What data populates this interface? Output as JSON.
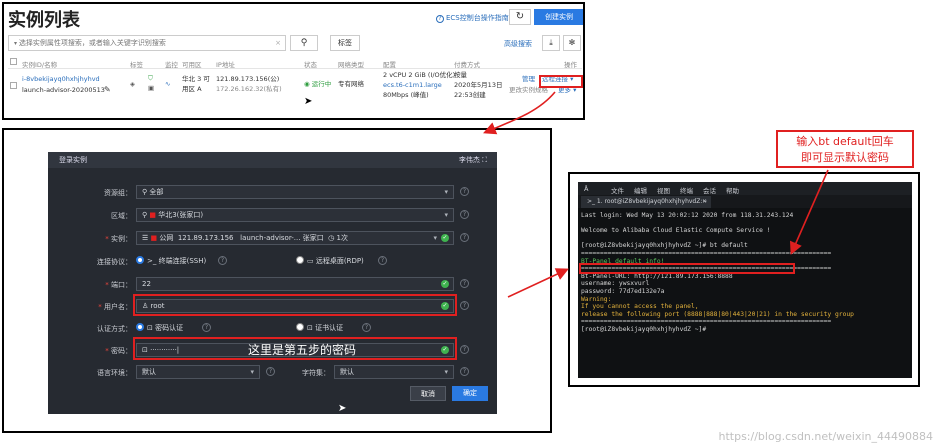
{
  "instance_list": {
    "title": "实例列表",
    "ecs_link": "ECS控制台操作指南",
    "create_button": "创建实例",
    "search_placeholder": "选择实例属性项搜索，或者输入关键字识别搜索",
    "tag_button": "标签",
    "advanced_search": "高级搜索",
    "columns": [
      "实例ID/名称",
      "标签",
      "监控",
      "可用区",
      "IP地址",
      "状态",
      "网络类型",
      "配置",
      "付费方式",
      "操作"
    ],
    "row": {
      "instance_id": "i-8vbekijayq0hxhjhyhvd",
      "instance_name": "launch-advisor-20200513",
      "zone_1": "华北 3 可",
      "zone_2": "用区 A",
      "ip_public": "121.89.173.156(公)",
      "ip_private": "172.26.162.32(私有)",
      "status": "运行中",
      "network_type": "专有网络",
      "config_1": "2 vCPU 2 GiB (I/O优化)",
      "config_2": "ecs.t6-c1m1.large",
      "config_3": "80Mbps (峰值)",
      "pay_1": "按量",
      "pay_2": "2020年5月13日",
      "pay_3": "22:53创建",
      "manage_link": "管理",
      "remote_link": "远程连接",
      "more_link": "更改实例规格",
      "more_2": "更多"
    }
  },
  "login_dialog": {
    "title": "登录实例",
    "header_right": "李伟杰",
    "fields": {
      "resource_group_label": "资源组：",
      "resource_group_value": "全部",
      "region_label": "区域：",
      "region_value": "华北3(张家口)",
      "instance_label": "实例：",
      "instance_public": "公网",
      "instance_ip": "121.89.173.156",
      "instance_name": "launch-advisor-...",
      "instance_zone": "张家口",
      "instance_count": "1次",
      "protocol_label": "连接协议：",
      "protocol_ssh": "终端连接(SSH)",
      "protocol_rdp": "远程桌面(RDP)",
      "port_label": "端口：",
      "port_value": "22",
      "username_label": "用户名：",
      "username_value": "root",
      "auth_label": "认证方式：",
      "auth_password": "密码认证",
      "auth_cert": "证书认证",
      "password_label": "密码：",
      "password_value": "············",
      "lang_label": "语言环境：",
      "lang_value": "默认",
      "charset_label": "字符集：",
      "charset_value": "默认"
    },
    "cancel_button": "取消",
    "ok_button": "确定",
    "annotation": "这里是第五步的密码"
  },
  "terminal": {
    "menu": [
      "文件",
      "编辑",
      "视图",
      "终端",
      "会话",
      "帮助"
    ],
    "tab": ">_ 1. root@iZ8vbekijayq0hxhjhyhvdZ:~",
    "lines": {
      "login": "Last login: Wed May 13 20:02:12 2020 from 118.31.243.124",
      "welcome": "Welcome to Alibaba Cloud Elastic Compute Service !",
      "prompt_cmd": "[root@iZ8vbekijayq0hxhjhyhvdZ ~]# bt default",
      "sep1": "==================================================================",
      "panel_info": "BT-Panel default info!",
      "sep2": "==================================================================",
      "url": "Bt-Panel-URL: http://121.89.173.156:8888",
      "user": "username: ywsxvurl",
      "pass": "password: 77d7ed132e7a",
      "warning": "Warning:",
      "warn1": "If you cannot access the panel,",
      "warn2": "release the following port (8888|888|80|443|20|21) in the security group",
      "sep3": "==================================================================",
      "prompt_end": "[root@iZ8vbekijayq0hxhjhyhvdZ ~]#"
    }
  },
  "callout": {
    "line1": "输入bt default回车",
    "line2": "即可显示默认密码"
  },
  "watermark": "https://blog.csdn.net/weixin_44490884",
  "colors": {
    "accent_blue": "#2a7ae2",
    "annotation_red": "#e02020",
    "dialog_bg": "#262a31",
    "terminal_bg": "#0f1113"
  }
}
